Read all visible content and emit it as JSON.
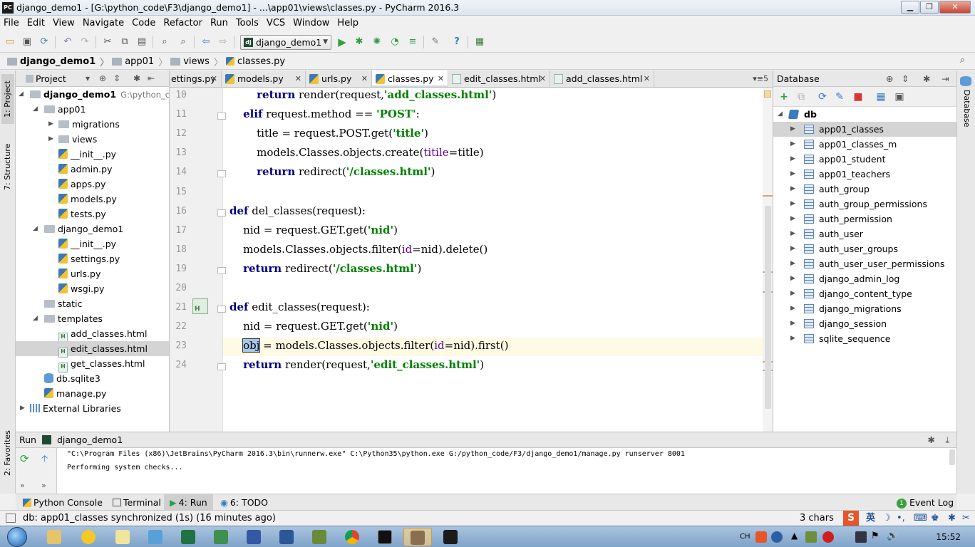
{
  "window": {
    "title": "django_demo1 - [G:\\python_code\\F3\\django_demo1] - ...\\app01\\views\\classes.py - PyCharm 2016.3",
    "app_icon": "PC"
  },
  "menu": [
    "File",
    "Edit",
    "View",
    "Navigate",
    "Code",
    "Refactor",
    "Run",
    "Tools",
    "VCS",
    "Window",
    "Help"
  ],
  "toolbar": {
    "run_config": "django_demo1",
    "run_config_icon": "dj"
  },
  "breadcrumb": [
    "django_demo1",
    "app01",
    "views",
    "classes.py"
  ],
  "left_stripe": {
    "project_tab": "1: Project",
    "structure_tab": "7: Structure",
    "favorites_tab": "2: Favorites"
  },
  "project": {
    "header": "Project",
    "tree": [
      {
        "label": "django_demo1",
        "suffix": "G:\\python_co",
        "type": "folder",
        "depth": 0,
        "expanded": true,
        "bold": true
      },
      {
        "label": "app01",
        "type": "folder",
        "depth": 1,
        "expanded": true
      },
      {
        "label": "migrations",
        "type": "folder",
        "depth": 2,
        "expanded": false
      },
      {
        "label": "views",
        "type": "folder",
        "depth": 2,
        "expanded": false
      },
      {
        "label": "__init__.py",
        "type": "py",
        "depth": 2
      },
      {
        "label": "admin.py",
        "type": "py",
        "depth": 2
      },
      {
        "label": "apps.py",
        "type": "py",
        "depth": 2
      },
      {
        "label": "models.py",
        "type": "py",
        "depth": 2
      },
      {
        "label": "tests.py",
        "type": "py",
        "depth": 2
      },
      {
        "label": "django_demo1",
        "type": "folder",
        "depth": 1,
        "expanded": true
      },
      {
        "label": "__init__.py",
        "type": "py",
        "depth": 2
      },
      {
        "label": "settings.py",
        "type": "py",
        "depth": 2
      },
      {
        "label": "urls.py",
        "type": "py",
        "depth": 2
      },
      {
        "label": "wsgi.py",
        "type": "py",
        "depth": 2
      },
      {
        "label": "static",
        "type": "folder",
        "depth": 1
      },
      {
        "label": "templates",
        "type": "folder",
        "depth": 1,
        "expanded": true
      },
      {
        "label": "add_classes.html",
        "type": "html",
        "depth": 2
      },
      {
        "label": "edit_classes.html",
        "type": "html",
        "depth": 2,
        "selected": true
      },
      {
        "label": "get_classes.html",
        "type": "html",
        "depth": 2
      },
      {
        "label": "db.sqlite3",
        "type": "db",
        "depth": 1
      },
      {
        "label": "manage.py",
        "type": "py",
        "depth": 1
      },
      {
        "label": "External Libraries",
        "type": "lib",
        "depth": 0,
        "expanded": false
      }
    ]
  },
  "tabs": [
    {
      "label": "ettings.py",
      "type": "py"
    },
    {
      "label": "models.py",
      "type": "py"
    },
    {
      "label": "urls.py",
      "type": "py"
    },
    {
      "label": "classes.py",
      "type": "py",
      "active": true
    },
    {
      "label": "edit_classes.html",
      "type": "html"
    },
    {
      "label": "add_classes.html",
      "type": "html"
    }
  ],
  "tabs_overflow": "5",
  "editor": {
    "lines": [
      {
        "n": "10",
        "tokens": [
          [
            "",
            "        "
          ],
          [
            "kw",
            "return"
          ],
          [
            "",
            " render(request,"
          ],
          [
            "str",
            "'add_classes.html'"
          ],
          [
            "",
            ")"
          ]
        ]
      },
      {
        "n": "11",
        "tokens": [
          [
            "",
            "    "
          ],
          [
            "kw",
            "elif"
          ],
          [
            "",
            " request.method == "
          ],
          [
            "str",
            "'POST'"
          ],
          [
            "",
            ":"
          ]
        ]
      },
      {
        "n": "12",
        "tokens": [
          [
            "",
            "        title = request.POST.get("
          ],
          [
            "str",
            "'title'"
          ],
          [
            "",
            ")"
          ]
        ]
      },
      {
        "n": "13",
        "tokens": [
          [
            "",
            "        models.Classes.objects.create("
          ],
          [
            "prm",
            "titile"
          ],
          [
            "",
            "=title)"
          ]
        ]
      },
      {
        "n": "14",
        "tokens": [
          [
            "",
            "        "
          ],
          [
            "kw",
            "return"
          ],
          [
            "",
            " redirect("
          ],
          [
            "str",
            "'/classes.html'"
          ],
          [
            "",
            ")"
          ]
        ]
      },
      {
        "n": "15",
        "tokens": []
      },
      {
        "n": "16",
        "tokens": [
          [
            "kw",
            "def"
          ],
          [
            "",
            " del_classes(request):"
          ]
        ]
      },
      {
        "n": "17",
        "tokens": [
          [
            "",
            "    nid = request.GET.get("
          ],
          [
            "str",
            "'nid'"
          ],
          [
            "",
            ")"
          ]
        ]
      },
      {
        "n": "18",
        "tokens": [
          [
            "",
            "    models.Classes.objects.filter("
          ],
          [
            "prm",
            "id"
          ],
          [
            "",
            "=nid).delete()"
          ]
        ]
      },
      {
        "n": "19",
        "tokens": [
          [
            "",
            "    "
          ],
          [
            "kw",
            "return"
          ],
          [
            "",
            " redirect("
          ],
          [
            "str",
            "'/classes.html'"
          ],
          [
            "",
            ")"
          ]
        ]
      },
      {
        "n": "20",
        "tokens": []
      },
      {
        "n": "21",
        "tokens": [
          [
            "kw",
            "def"
          ],
          [
            "",
            " edit_classes(request):"
          ]
        ]
      },
      {
        "n": "22",
        "tokens": [
          [
            "",
            "    nid = request.GET.get("
          ],
          [
            "str",
            "'nid'"
          ],
          [
            "",
            ")"
          ]
        ]
      },
      {
        "n": "23",
        "tokens": [
          [
            "",
            "    "
          ],
          [
            "sel",
            "obj"
          ],
          [
            "",
            " = models.Classes.objects.filter("
          ],
          [
            "prm",
            "id"
          ],
          [
            "",
            "=nid).first()"
          ]
        ]
      },
      {
        "n": "24",
        "tokens": [
          [
            "",
            "    "
          ],
          [
            "kw",
            "return"
          ],
          [
            "",
            " render(request,"
          ],
          [
            "str",
            "'edit_classes.html'"
          ],
          [
            "",
            ")"
          ]
        ]
      }
    ]
  },
  "database": {
    "header": "Database",
    "root": "db",
    "tables": [
      "app01_classes",
      "app01_classes_m",
      "app01_student",
      "app01_teachers",
      "auth_group",
      "auth_group_permissions",
      "auth_permission",
      "auth_user",
      "auth_user_groups",
      "auth_user_user_permissions",
      "django_admin_log",
      "django_content_type",
      "django_migrations",
      "django_session",
      "sqlite_sequence"
    ],
    "right_stripe_tab": "Database"
  },
  "run": {
    "label": "Run",
    "config": "django_demo1",
    "output": [
      "\"C:\\Program Files (x86)\\JetBrains\\PyCharm 2016.3\\bin\\runnerw.exe\" C:\\Python35\\python.exe G:/python_code/F3/django_demo1/manage.py runserver 8001",
      "Performing system checks..."
    ]
  },
  "bottom_tabs": [
    {
      "label": "Python Console"
    },
    {
      "label": "Terminal"
    },
    {
      "label": "4: Run",
      "active": true
    },
    {
      "label": "6: TODO"
    }
  ],
  "event_log": {
    "label": "Event Log",
    "count": "1"
  },
  "status": {
    "message": "db: app01_classes synchronized (1s) (16 minutes ago)",
    "chars": "3 chars"
  },
  "ime": {
    "label": "英"
  },
  "taskbar": {
    "time": "15:52",
    "lang": "CH"
  }
}
